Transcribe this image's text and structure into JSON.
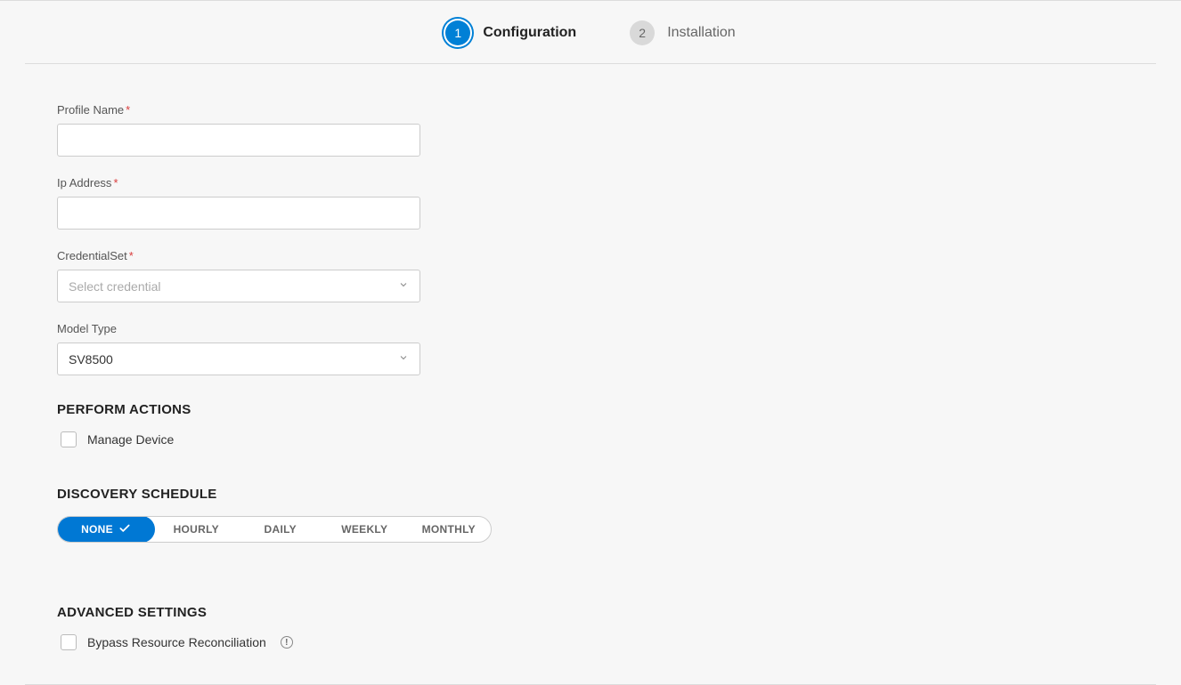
{
  "stepper": {
    "step1_number": "1",
    "step1_label": "Configuration",
    "step2_number": "2",
    "step2_label": "Installation"
  },
  "form": {
    "profile_name": {
      "label": "Profile Name",
      "value": ""
    },
    "ip_address": {
      "label": "Ip Address",
      "value": ""
    },
    "credential_set": {
      "label": "CredentialSet",
      "placeholder": "Select credential",
      "value": ""
    },
    "model_type": {
      "label": "Model Type",
      "value": "SV8500"
    }
  },
  "sections": {
    "perform_actions": "PERFORM ACTIONS",
    "discovery_schedule": "DISCOVERY SCHEDULE",
    "advanced_settings": "ADVANCED SETTINGS"
  },
  "perform_actions": {
    "manage_device_label": "Manage Device",
    "manage_device_checked": false
  },
  "discovery_schedule": {
    "options": {
      "none": "NONE",
      "hourly": "HOURLY",
      "daily": "DAILY",
      "weekly": "WEEKLY",
      "monthly": "MONTHLY"
    },
    "selected": "NONE"
  },
  "advanced_settings": {
    "bypass_label": "Bypass Resource Reconciliation",
    "bypass_checked": false
  }
}
